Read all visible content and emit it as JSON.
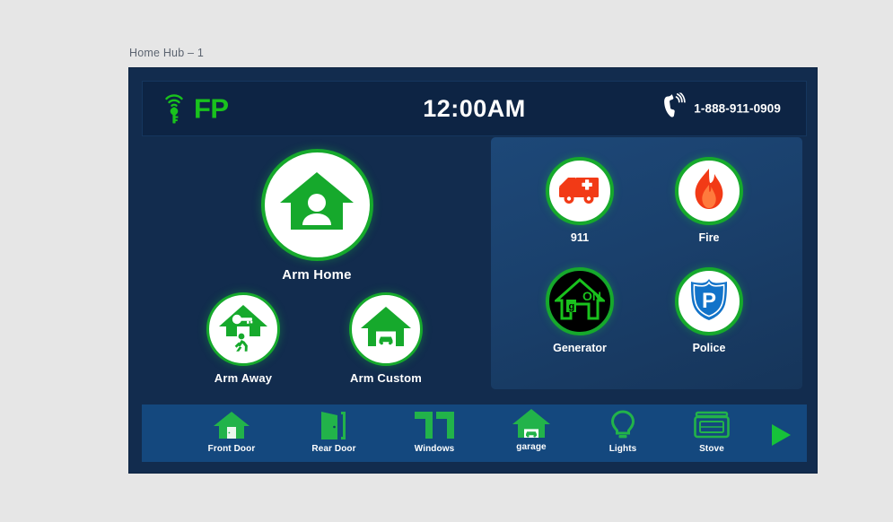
{
  "window": {
    "title": "Home Hub – 1"
  },
  "header": {
    "logo_icon": "key-wifi-icon",
    "logo_text": "FP",
    "clock": "12:00AM",
    "phone_icon": "ringing-phone-icon",
    "phone_number": "1-888-911-0909"
  },
  "arm_controls": [
    {
      "id": "arm-home",
      "label": "Arm Home",
      "icon": "house-person-icon"
    },
    {
      "id": "arm-away",
      "label": "Arm Away",
      "icon": "house-key-walking-person-icon"
    },
    {
      "id": "arm-custom",
      "label": "Arm Custom",
      "icon": "house-garage-car-icon"
    }
  ],
  "emergency": [
    {
      "id": "911",
      "label": "911",
      "icon": "ambulance-icon",
      "state": "light"
    },
    {
      "id": "fire",
      "label": "Fire",
      "icon": "flame-icon",
      "state": "light"
    },
    {
      "id": "generator",
      "label": "Generator",
      "icon": "generator-house-on-icon",
      "state": "dark",
      "status": "ON",
      "badge": "g"
    },
    {
      "id": "police",
      "label": "Police",
      "icon": "police-shield-p-icon",
      "state": "light"
    }
  ],
  "toolbar": [
    {
      "id": "front-door",
      "label": "Front Door",
      "icon": "house-door-icon"
    },
    {
      "id": "rear-door",
      "label": "Rear Door",
      "icon": "open-door-icon"
    },
    {
      "id": "windows",
      "label": "Windows",
      "icon": "windows-icon"
    },
    {
      "id": "garage",
      "label": "garage",
      "icon": "garage-car-icon"
    },
    {
      "id": "lights",
      "label": "Lights",
      "icon": "lightbulb-icon"
    },
    {
      "id": "stove",
      "label": "Stove",
      "icon": "stove-icon"
    },
    {
      "id": "next",
      "label": "",
      "icon": "play-arrow-icon"
    }
  ],
  "colors": {
    "accent_green": "#19c21d",
    "ring_green": "#16a92c",
    "frame_navy": "#122c4e",
    "header_navy": "#0d2444",
    "panel_blue": "#1d4878",
    "toolbar_blue": "#14487e",
    "alert_red": "#f23a16",
    "police_blue": "#1273c9"
  }
}
